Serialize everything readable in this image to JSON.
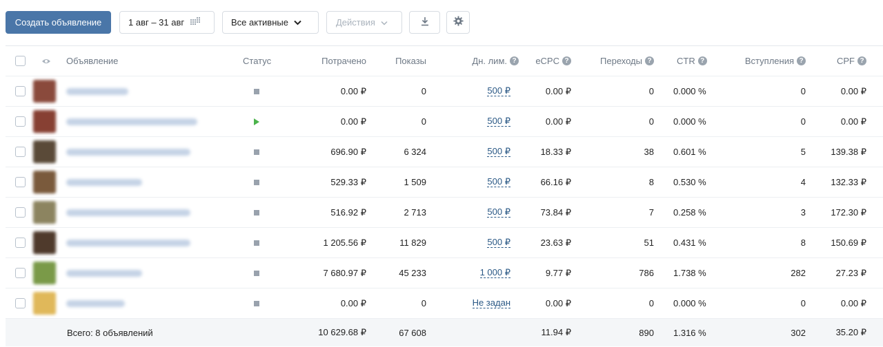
{
  "toolbar": {
    "create_label": "Создать объявление",
    "date_range": "1 авг – 31 авг",
    "filter_label": "Все активные",
    "actions_label": "Действия",
    "download_icon": "download-icon",
    "settings_icon": "gear-icon"
  },
  "columns": {
    "ad": "Объявление",
    "status": "Статус",
    "spent": "Потрачено",
    "shows": "Показы",
    "limit": "Дн. лим.",
    "ecpc": "eCPC",
    "clicks": "Переходы",
    "ctr": "CTR",
    "joins": "Вступления",
    "cpf": "CPF"
  },
  "rows": [
    {
      "status": "paused",
      "spent": "0.00 ₽",
      "shows": "0",
      "limit": "500 ₽",
      "ecpc": "0.00 ₽",
      "clicks": "0",
      "ctr": "0.000 %",
      "joins": "0",
      "cpf": "0.00 ₽",
      "thumb_color": "#8a4a3c"
    },
    {
      "status": "running",
      "spent": "0.00 ₽",
      "shows": "0",
      "limit": "500 ₽",
      "ecpc": "0.00 ₽",
      "clicks": "0",
      "ctr": "0.000 %",
      "joins": "0",
      "cpf": "0.00 ₽",
      "thumb_color": "#874033"
    },
    {
      "status": "paused",
      "spent": "696.90 ₽",
      "shows": "6 324",
      "limit": "500 ₽",
      "ecpc": "18.33 ₽",
      "clicks": "38",
      "ctr": "0.601 %",
      "joins": "5",
      "cpf": "139.38 ₽",
      "thumb_color": "#5a4a38"
    },
    {
      "status": "paused",
      "spent": "529.33 ₽",
      "shows": "1 509",
      "limit": "500 ₽",
      "ecpc": "66.16 ₽",
      "clicks": "8",
      "ctr": "0.530 %",
      "joins": "4",
      "cpf": "132.33 ₽",
      "thumb_color": "#7a5a3c"
    },
    {
      "status": "paused",
      "spent": "516.92 ₽",
      "shows": "2 713",
      "limit": "500 ₽",
      "ecpc": "73.84 ₽",
      "clicks": "7",
      "ctr": "0.258 %",
      "joins": "3",
      "cpf": "172.30 ₽",
      "thumb_color": "#8c8460"
    },
    {
      "status": "paused",
      "spent": "1 205.56 ₽",
      "shows": "11 829",
      "limit": "500 ₽",
      "ecpc": "23.63 ₽",
      "clicks": "51",
      "ctr": "0.431 %",
      "joins": "8",
      "cpf": "150.69 ₽",
      "thumb_color": "#4f3a2c"
    },
    {
      "status": "paused",
      "spent": "7 680.97 ₽",
      "shows": "45 233",
      "limit": "1 000 ₽",
      "ecpc": "9.77 ₽",
      "clicks": "786",
      "ctr": "1.738 %",
      "joins": "282",
      "cpf": "27.23 ₽",
      "thumb_color": "#7a9a48"
    },
    {
      "status": "paused",
      "spent": "0.00 ₽",
      "shows": "0",
      "limit": "Не задан",
      "ecpc": "0.00 ₽",
      "clicks": "0",
      "ctr": "0.000 %",
      "joins": "0",
      "cpf": "0.00 ₽",
      "thumb_color": "#e0b85a"
    }
  ],
  "total": {
    "label": "Всего: 8 объявлений",
    "spent": "10 629.68 ₽",
    "shows": "67 608",
    "ecpc": "11.94 ₽",
    "clicks": "890",
    "ctr": "1.316 %",
    "joins": "302",
    "cpf": "35.20 ₽"
  },
  "colors": {
    "accent": "#4a76a8",
    "running": "#4bb34b",
    "link": "#2a5885"
  }
}
